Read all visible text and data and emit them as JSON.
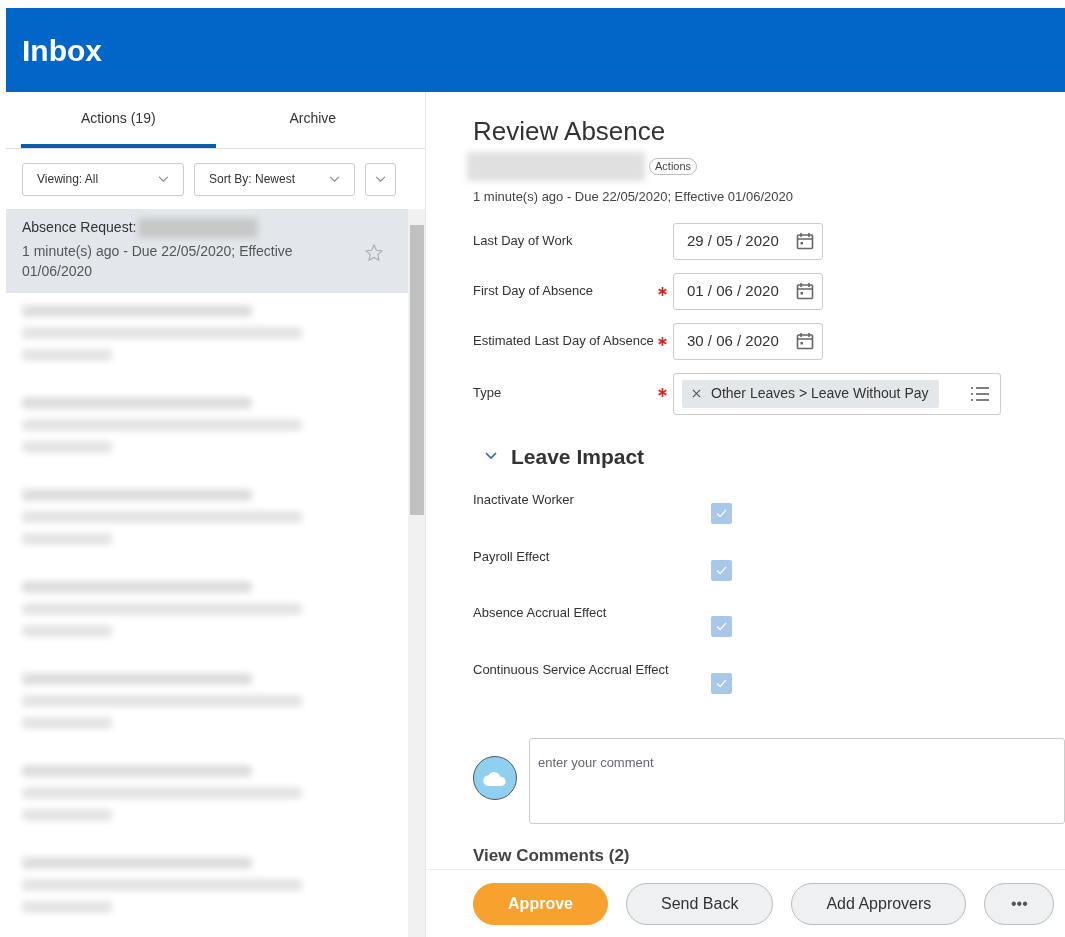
{
  "header": {
    "title": "Inbox"
  },
  "tabs": [
    {
      "label": "Actions (19)",
      "selected": true
    },
    {
      "label": "Archive",
      "selected": false
    }
  ],
  "filters": [
    {
      "label": "Viewing: All"
    },
    {
      "label": "Sort By: Newest"
    }
  ],
  "inbox_items": [
    {
      "title": "Absence Request:",
      "subtitle": "1 minute(s) ago - Due 22/05/2020; Effective 01/06/2020",
      "selected": true,
      "starred": false,
      "redacted": false
    },
    {
      "redacted": true
    },
    {
      "redacted": true
    },
    {
      "redacted": true
    },
    {
      "redacted": true
    },
    {
      "redacted": true
    },
    {
      "redacted": true
    },
    {
      "redacted": true
    }
  ],
  "detail": {
    "title": "Review Absence",
    "subject_redacted": true,
    "actions_label": "Actions",
    "meta": "1 minute(s) ago - Due 22/05/2020; Effective 01/06/2020",
    "fields": [
      {
        "kind": "date",
        "label": "Last Day of Work",
        "required": false,
        "value": "29 / 05 / 2020"
      },
      {
        "kind": "date",
        "label": "First Day of Absence",
        "required": true,
        "value": "01 / 06 / 2020"
      },
      {
        "kind": "date",
        "label": "Estimated Last Day of Absence",
        "required": true,
        "value": "30 / 06 / 2020"
      },
      {
        "kind": "select",
        "label": "Type",
        "required": true,
        "value": "Other Leaves > Leave Without Pay"
      }
    ],
    "section": {
      "title": "Leave Impact",
      "expanded": true,
      "checks": [
        {
          "label": "Inactivate Worker",
          "checked": true
        },
        {
          "label": "Payroll Effect",
          "checked": true
        },
        {
          "label": "Absence Accrual Effect",
          "checked": true
        },
        {
          "label": "Continuous Service Accrual Effect",
          "checked": true
        }
      ]
    },
    "comment": {
      "placeholder": "enter your comment"
    },
    "view_comments": "View Comments (2)"
  },
  "buttons": [
    {
      "label": "Approve",
      "kind": "primary"
    },
    {
      "label": "Send Back",
      "kind": "secondary"
    },
    {
      "label": "Add Approvers",
      "kind": "secondary"
    },
    {
      "label": "•••",
      "kind": "more"
    }
  ]
}
